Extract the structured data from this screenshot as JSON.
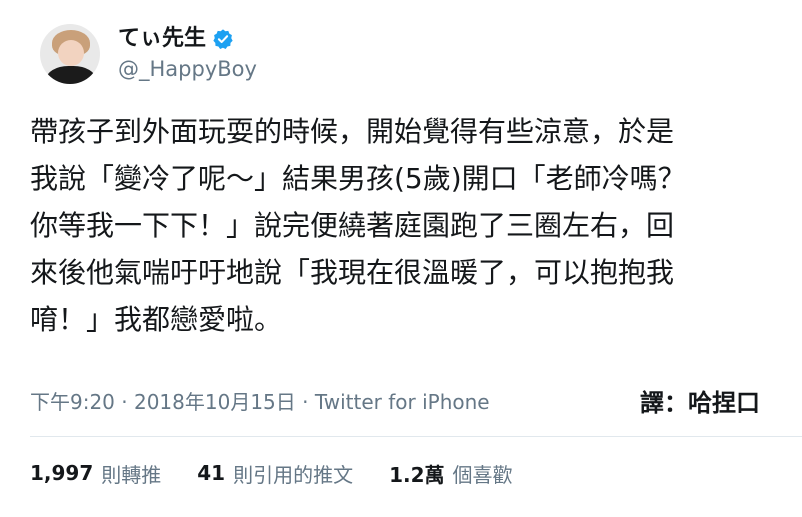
{
  "user": {
    "display_name": "てぃ先生",
    "handle": "@_HappyBoy",
    "verified_color": "#1da1f2"
  },
  "tweet": {
    "lines": [
      "帶孩子到外面玩耍的時候，開始覺得有些涼意，於是",
      "我說「變冷了呢～」結果男孩(5歲)開口「老師冷嗎？",
      "你等我一下下！」說完便繞著庭園跑了三圈左右，回",
      "來後他氣喘吁吁地說「我現在很溫暖了，可以抱抱我",
      "唷！」我都戀愛啦。"
    ],
    "meta": "下午9:20 · 2018年10月15日 · Twitter for iPhone",
    "translator": "譯：哈捏口"
  },
  "stats": [
    {
      "count": "1,997",
      "label": "則轉推"
    },
    {
      "count": "41",
      "label": "則引用的推文"
    },
    {
      "count": "1.2萬",
      "label": "個喜歡"
    }
  ],
  "colors": {
    "text": "#14171a",
    "secondary": "#657786",
    "divider": "#e1e8ed"
  }
}
